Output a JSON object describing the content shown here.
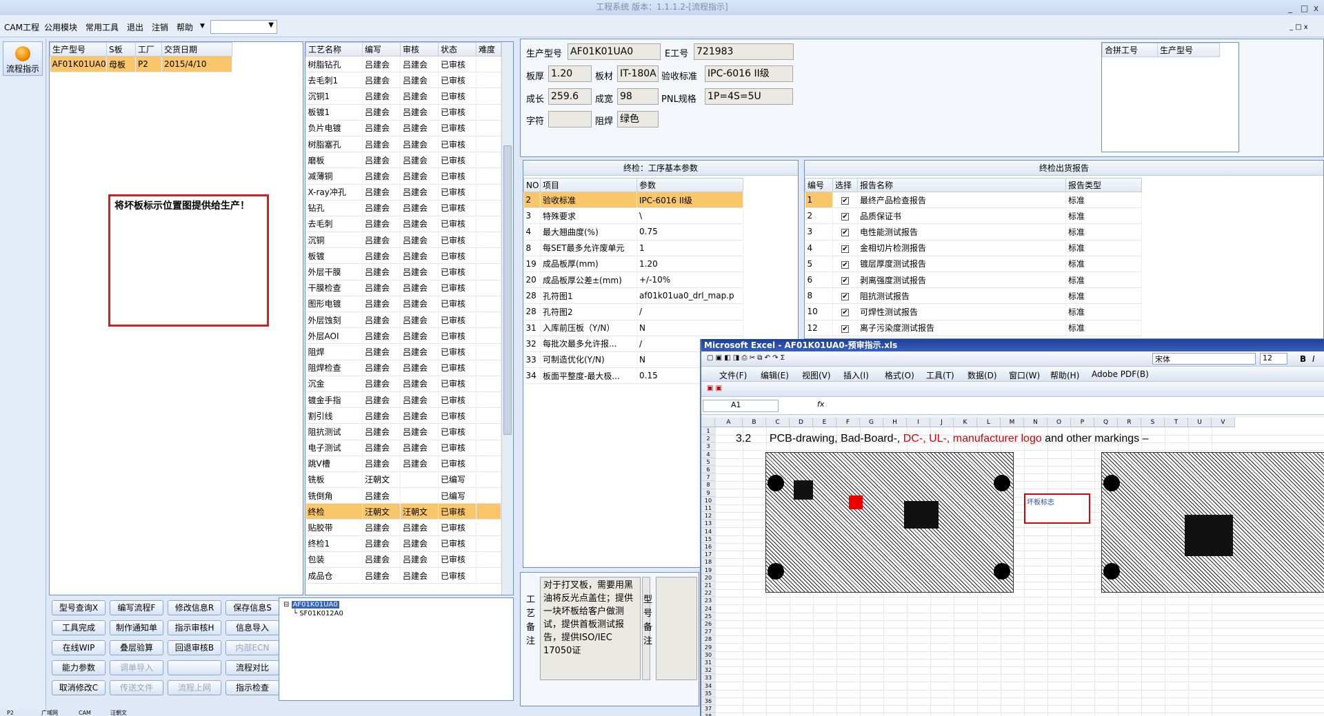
{
  "window": {
    "title": "工程系统 版本：1.1.1.2-[流程指示]",
    "min": "_",
    "max": "□",
    "close": "x"
  },
  "menu": [
    "CAM工程",
    "公用模块",
    "常用工具",
    "退出",
    "注销",
    "帮助"
  ],
  "sidebar": {
    "button": "流程指示"
  },
  "orders": {
    "headers": [
      "生产型号",
      "S板",
      "工厂",
      "交货日期"
    ],
    "rows": [
      [
        "AF01K01UA0",
        "母板",
        "P2",
        "2015/4/10"
      ]
    ]
  },
  "note_box": "将坏板标示位置图提供给生产！",
  "process": {
    "headers": [
      "工艺名称",
      "编写",
      "审核",
      "状态",
      "难度"
    ],
    "rows": [
      [
        "树脂钻孔",
        "吕建会",
        "吕建会",
        "已审核"
      ],
      [
        "去毛刺1",
        "吕建会",
        "吕建会",
        "已审核"
      ],
      [
        "沉铜1",
        "吕建会",
        "吕建会",
        "已审核"
      ],
      [
        "板镀1",
        "吕建会",
        "吕建会",
        "已审核"
      ],
      [
        "负片电镀",
        "吕建会",
        "吕建会",
        "已审核"
      ],
      [
        "树脂塞孔",
        "吕建会",
        "吕建会",
        "已审核"
      ],
      [
        "磨板",
        "吕建会",
        "吕建会",
        "已审核"
      ],
      [
        "减薄铜",
        "吕建会",
        "吕建会",
        "已审核"
      ],
      [
        "X-ray冲孔",
        "吕建会",
        "吕建会",
        "已审核"
      ],
      [
        "钻孔",
        "吕建会",
        "吕建会",
        "已审核"
      ],
      [
        "去毛刺",
        "吕建会",
        "吕建会",
        "已审核"
      ],
      [
        "沉铜",
        "吕建会",
        "吕建会",
        "已审核"
      ],
      [
        "板镀",
        "吕建会",
        "吕建会",
        "已审核"
      ],
      [
        "外层干膜",
        "吕建会",
        "吕建会",
        "已审核"
      ],
      [
        "干膜检查",
        "吕建会",
        "吕建会",
        "已审核"
      ],
      [
        "图形电镀",
        "吕建会",
        "吕建会",
        "已审核"
      ],
      [
        "外层蚀刻",
        "吕建会",
        "吕建会",
        "已审核"
      ],
      [
        "外层AOI",
        "吕建会",
        "吕建会",
        "已审核"
      ],
      [
        "阻焊",
        "吕建会",
        "吕建会",
        "已审核"
      ],
      [
        "阻焊检查",
        "吕建会",
        "吕建会",
        "已审核"
      ],
      [
        "沉金",
        "吕建会",
        "吕建会",
        "已审核"
      ],
      [
        "镀金手指",
        "吕建会",
        "吕建会",
        "已审核"
      ],
      [
        "割引线",
        "吕建会",
        "吕建会",
        "已审核"
      ],
      [
        "阻抗测试",
        "吕建会",
        "吕建会",
        "已审核"
      ],
      [
        "电子测试",
        "吕建会",
        "吕建会",
        "已审核"
      ],
      [
        "跳V槽",
        "吕建会",
        "吕建会",
        "已审核"
      ],
      [
        "铣板",
        "汪朝文",
        "",
        "已编写"
      ],
      [
        "铣倒角",
        "吕建会",
        "",
        "已编写"
      ],
      [
        "终检",
        "汪朝文",
        "汪朝文",
        "已审核"
      ],
      [
        "贴胶带",
        "吕建会",
        "吕建会",
        "已审核"
      ],
      [
        "终检1",
        "吕建会",
        "吕建会",
        "已审核"
      ],
      [
        "包装",
        "吕建会",
        "吕建会",
        "已审核"
      ],
      [
        "成品仓",
        "吕建会",
        "吕建会",
        "已审核"
      ]
    ],
    "selected": 28
  },
  "buttons": [
    [
      "型号查询X",
      "编写流程F",
      "修改信息R",
      "保存信息S"
    ],
    [
      "工具完成",
      "制作通知单",
      "指示审核H",
      "信息导入"
    ],
    [
      "在线WIP",
      "叠层验算",
      "回退审核B",
      "内部ECN"
    ],
    [
      "能力参数",
      "调单导入",
      "",
      "流程对比"
    ],
    [
      "取消修改C",
      "传送文件",
      "流程上网",
      "指示检查"
    ]
  ],
  "disabled_buttons": [
    "内部ECN",
    "调单导入",
    "传送文件",
    "流程上网"
  ],
  "tree": {
    "root": "AF01K01UA0",
    "child": "SF01K012A0"
  },
  "info": {
    "model_label": "生产型号",
    "model": "AF01K01UA0",
    "e_label": "E工号",
    "e": "721983",
    "thick_label": "板厚",
    "thick": "1.20",
    "mat_label": "板材",
    "mat": "IT-180A",
    "std_label": "验收标准",
    "std": "IPC-6016 II级",
    "len_label": "成长",
    "len": "259.6",
    "wid_label": "成宽",
    "wid": "98",
    "pnl_label": "PNL规格",
    "pnl": "1P=4S=5U",
    "char_label": "字符",
    "char": "",
    "mask_label": "阻焊",
    "mask": "绿色"
  },
  "merge": {
    "headers": [
      "合拼工号",
      "生产型号"
    ]
  },
  "params": {
    "title": "终检：工序基本参数",
    "headers": [
      "NO",
      "项目",
      "参数"
    ],
    "rows": [
      [
        "2",
        "验收标准",
        "IPC-6016 II级"
      ],
      [
        "3",
        "特殊要求",
        "\\"
      ],
      [
        "4",
        "最大翘曲度(%)",
        "0.75"
      ],
      [
        "8",
        "每SET最多允许废单元",
        "1"
      ],
      [
        "19",
        "成品板厚(mm)",
        "1.20"
      ],
      [
        "20",
        "成品板厚公差±(mm)",
        "+/-10%"
      ],
      [
        "28",
        "孔符图1",
        "af01k01ua0_drl_map.p"
      ],
      [
        "28",
        "孔符图2",
        "/"
      ],
      [
        "31",
        "入库前压板（Y/N）",
        "N"
      ],
      [
        "32",
        "每批次最多允许报...",
        "/"
      ],
      [
        "33",
        "可制造优化(Y/N)",
        "N"
      ],
      [
        "34",
        "板面平整度-最大极...",
        "0.15"
      ]
    ]
  },
  "reports": {
    "title": "终检出货报告",
    "headers": [
      "编号",
      "选择",
      "报告名称",
      "报告类型"
    ],
    "rows": [
      [
        "1",
        "✔",
        "最终产品检查报告",
        "标准"
      ],
      [
        "2",
        "✔",
        "品质保证书",
        "标准"
      ],
      [
        "3",
        "✔",
        "电性能测试报告",
        "标准"
      ],
      [
        "4",
        "✔",
        "金相切片检测报告",
        "标准"
      ],
      [
        "5",
        "✔",
        "镀层厚度测试报告",
        "标准"
      ],
      [
        "6",
        "✔",
        "剥离强度测试报告",
        "标准"
      ],
      [
        "8",
        "✔",
        "阻抗测试报告",
        "标准"
      ],
      [
        "10",
        "✔",
        "可焊性测试报告",
        "标准"
      ],
      [
        "12",
        "✔",
        "离子污染度测试报告",
        "标准"
      ]
    ]
  },
  "process_note": {
    "label": "工艺备注",
    "text": "对于打叉板，需要用黑油将反光点盖住；提供一块坏板给客户做测试，提供首板测试报告，提供ISO/IEC 17050证",
    "label2": "型号备注"
  },
  "bottom_tabs": [
    "P2",
    "广域网",
    "CAM",
    "汪朝文"
  ],
  "excel": {
    "title": "Microsoft Excel - AF01K01UA0-预审指示.xls",
    "menus": [
      "文件(F)",
      "编辑(E)",
      "视图(V)",
      "插入(I)",
      "格式(O)",
      "工具(T)",
      "数据(D)",
      "窗口(W)",
      "帮助(H)",
      "Adobe PDF(B)"
    ],
    "font": "宋体",
    "size": "12",
    "cell": "A1",
    "fx": "fx",
    "columns": [
      "A",
      "B",
      "C",
      "D",
      "E",
      "F",
      "G",
      "H",
      "I",
      "J",
      "K",
      "L",
      "M",
      "N",
      "O",
      "P",
      "Q",
      "R",
      "S",
      "T",
      "U",
      "V"
    ],
    "heading_num": "3.2",
    "heading_a": "PCB-drawing, Bad-Board-, ",
    "heading_red": "DC-, UL-, manufacturer logo",
    "heading_b": " and other markings –",
    "callout": "坏板标志"
  }
}
